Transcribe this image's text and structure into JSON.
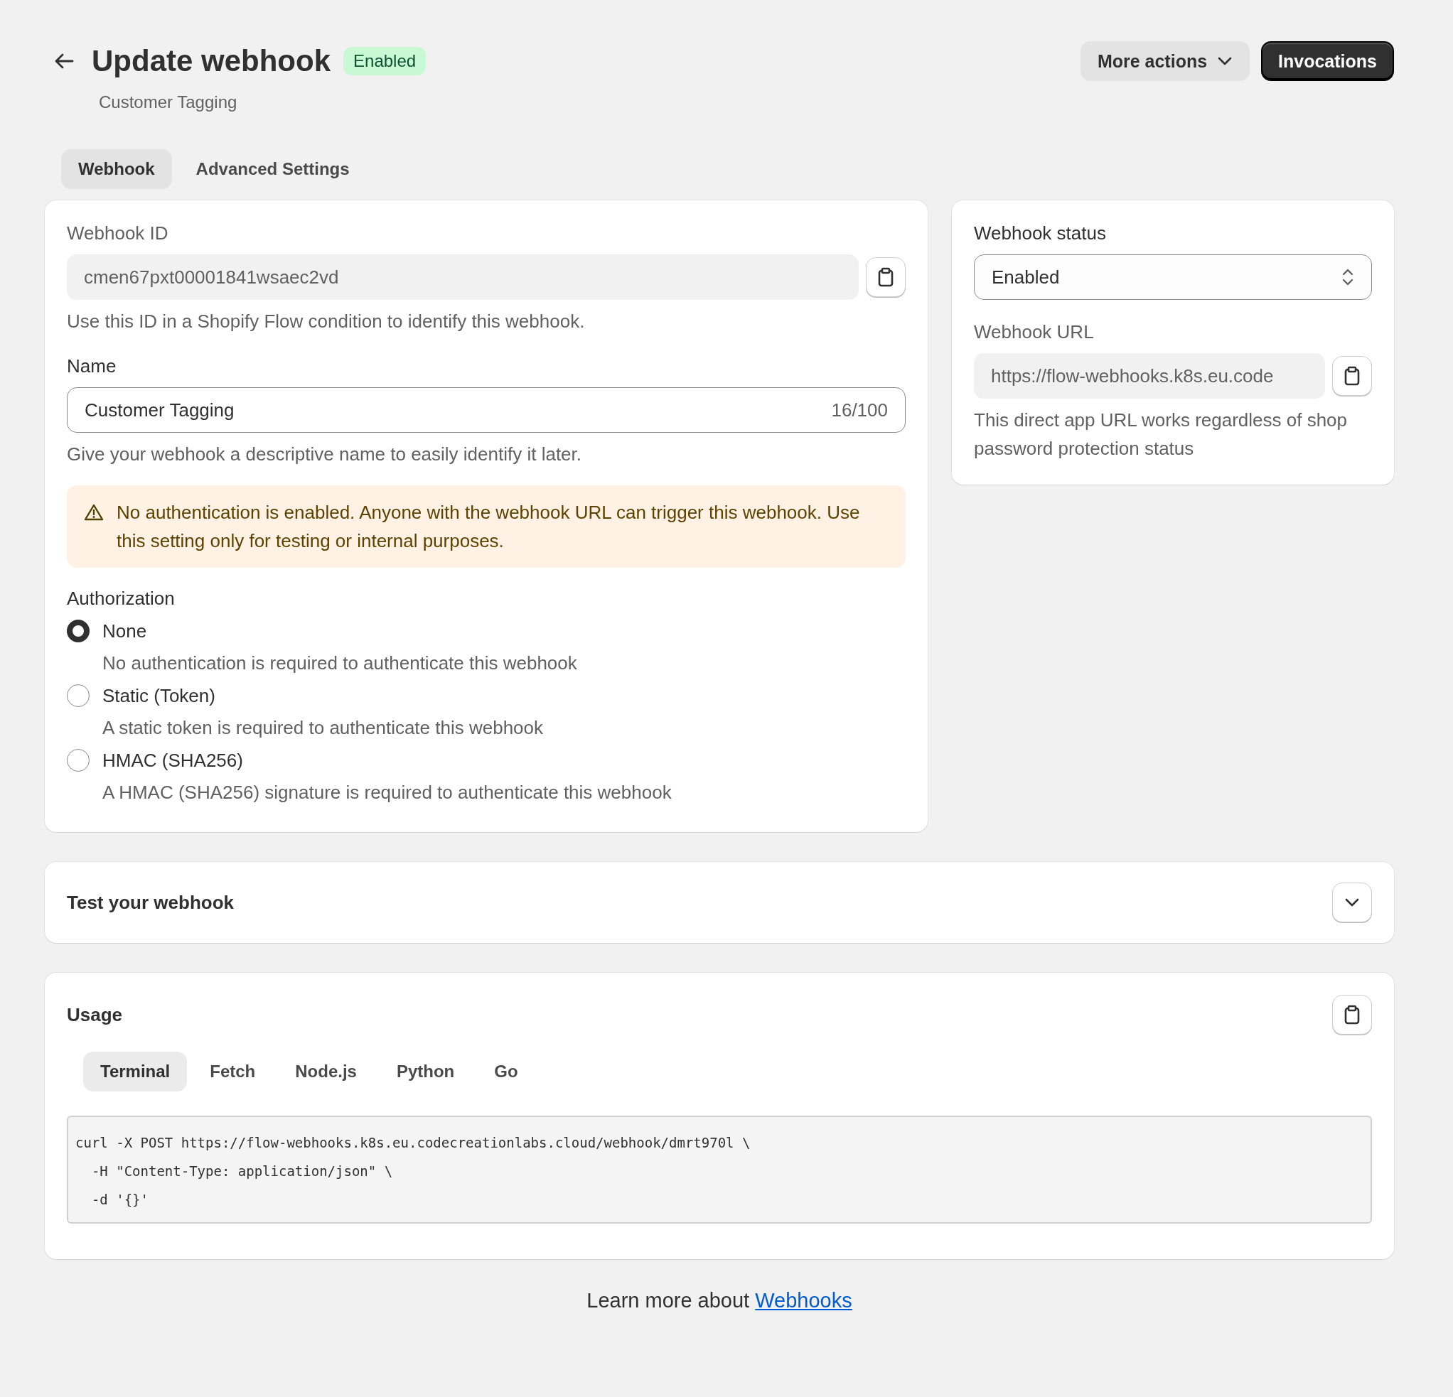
{
  "header": {
    "title": "Update webhook",
    "badge": "Enabled",
    "subtitle": "Customer Tagging",
    "actions": [
      {
        "label": "More actions",
        "kind": "menu"
      },
      {
        "label": "Invocations",
        "kind": "primary"
      }
    ]
  },
  "tabs": [
    {
      "label": "Webhook",
      "selected": true
    },
    {
      "label": "Advanced Settings",
      "selected": false
    }
  ],
  "webhook": {
    "id_label": "Webhook ID",
    "id_value": "cmen67pxt00001841wsaec2vd",
    "id_help": "Use this ID in a Shopify Flow condition to identify this webhook.",
    "name_label": "Name",
    "name_value": "Customer Tagging",
    "name_count": "16/100",
    "name_help": "Give your webhook a descriptive name to easily identify it later.",
    "warning": "No authentication is enabled. Anyone with the webhook URL can trigger this webhook. Use this setting only for testing or internal purposes.",
    "auth_label": "Authorization",
    "auth_options": [
      {
        "label": "None",
        "description": "No authentication is required to authenticate this webhook",
        "selected": true
      },
      {
        "label": "Static (Token)",
        "description": "A static token is required to authenticate this webhook",
        "selected": false
      },
      {
        "label": "HMAC (SHA256)",
        "description": "A HMAC (SHA256) signature is required to authenticate this webhook",
        "selected": false
      }
    ]
  },
  "status": {
    "label": "Webhook status",
    "value": "Enabled",
    "url_label": "Webhook URL",
    "url_value": "https://flow-webhooks.k8s.eu.code",
    "url_help": "This direct app URL works regardless of shop password protection status"
  },
  "test": {
    "title": "Test your webhook",
    "expanded": false
  },
  "usage": {
    "title": "Usage",
    "tabs": [
      {
        "label": "Terminal",
        "selected": true
      },
      {
        "label": "Fetch",
        "selected": false
      },
      {
        "label": "Node.js",
        "selected": false
      },
      {
        "label": "Python",
        "selected": false
      },
      {
        "label": "Go",
        "selected": false
      }
    ],
    "code": [
      "curl -X POST https://flow-webhooks.k8s.eu.codecreationlabs.cloud/webhook/dmrt970l \\",
      "  -H \"Content-Type: application/json\" \\",
      "  -d '{}'"
    ]
  },
  "footer": {
    "text": "Learn more about",
    "link": "Webhooks"
  }
}
